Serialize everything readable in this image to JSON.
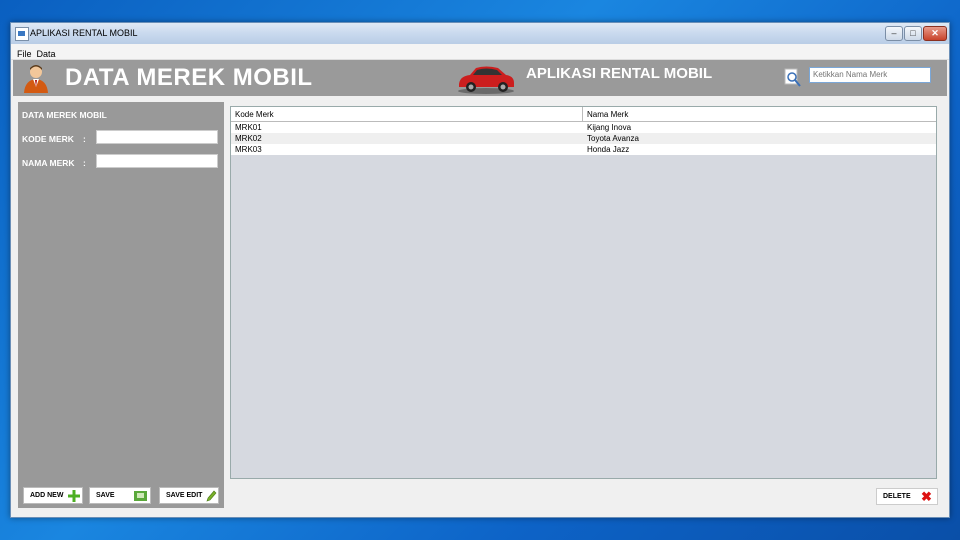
{
  "window": {
    "title": "APLIKASI RENTAL MOBIL",
    "min": "–",
    "max": "□",
    "close": "✕"
  },
  "menu": {
    "items": [
      "File",
      "Data"
    ]
  },
  "header": {
    "title": "DATA MEREK MOBIL",
    "app_title": "APLIKASI RENTAL MOBIL",
    "search_placeholder": "Ketikkan Nama Merk",
    "icons": [
      "person-icon",
      "car-icon",
      "search-icon"
    ]
  },
  "form": {
    "title": "DATA MEREK MOBIL",
    "kode_label": "KODE MERK",
    "nama_label": "NAMA MERK",
    "colon": ":",
    "kode_value": "",
    "nama_value": ""
  },
  "buttons": {
    "add_new": "ADD NEW",
    "save": "SAVE",
    "save_edit": "SAVE EDIT",
    "delete": "DELETE"
  },
  "table": {
    "columns": [
      "Kode Merk",
      "Nama Merk"
    ],
    "rows": [
      [
        "MRK01",
        "Kijang Inova"
      ],
      [
        "MRK02",
        "Toyota Avanza"
      ],
      [
        "MRK03",
        "Honda Jazz"
      ]
    ]
  },
  "colors": {
    "header_bg": "#9a9a9a",
    "panel_bg": "#999999",
    "table_bg": "#d6d9e0",
    "add_green": "#4caf22",
    "delete_red": "#dd1111"
  }
}
